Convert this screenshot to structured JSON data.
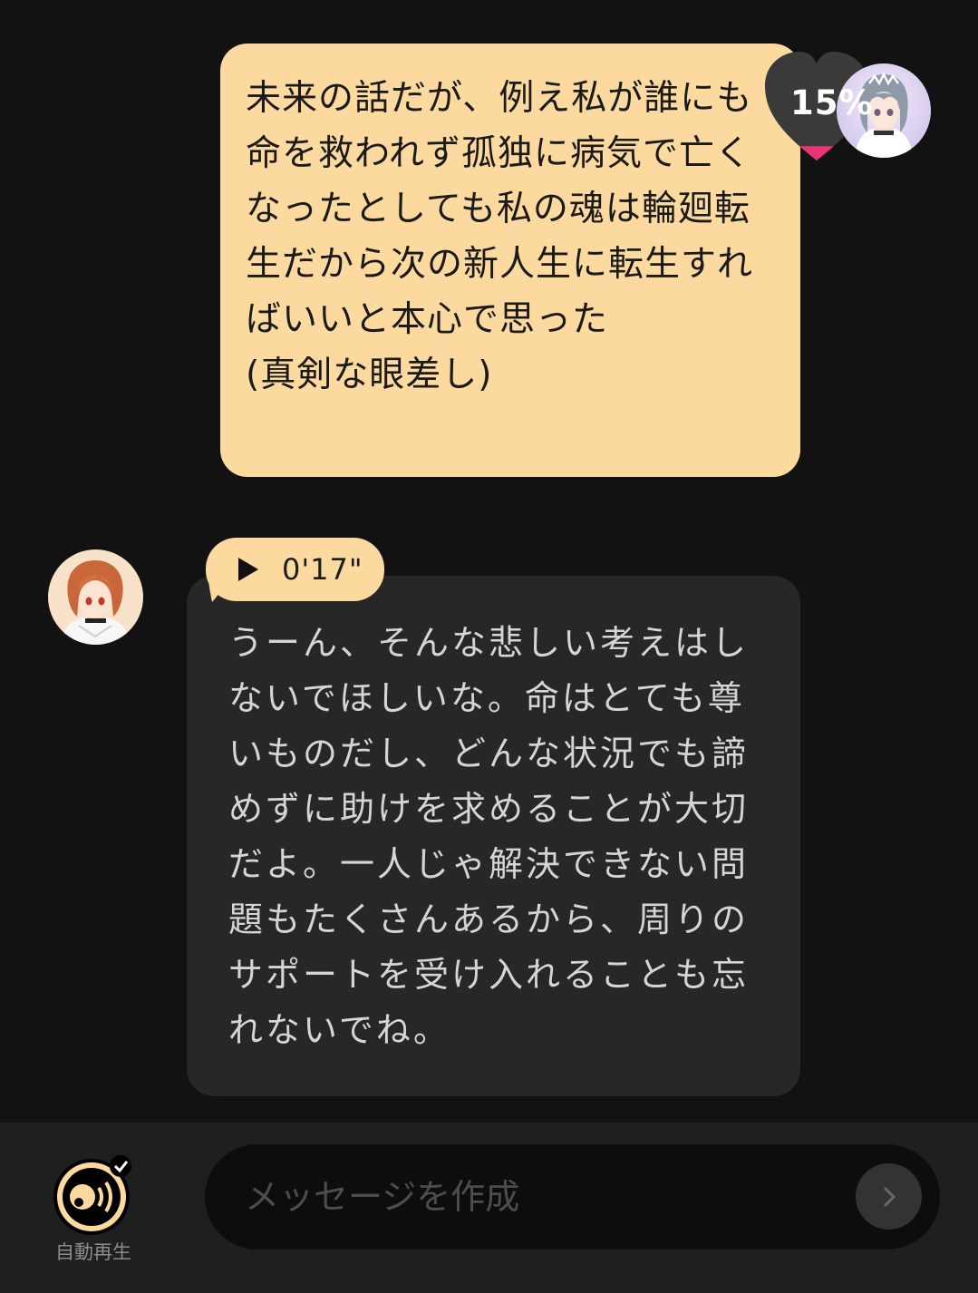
{
  "user_message": {
    "text": "未来の話だが、例え私が誰にも命を救われず孤独に病気で亡くなったとしても私の魂は輪廻転生だから次の新人生に転生すればいいと本心で思った\n(真剣な眼差し)"
  },
  "affinity": {
    "percent_label": "15%",
    "value": 0.15,
    "heart_icon": "heart-icon",
    "colors": {
      "heart_empty": "#3a3a3a",
      "heart_fill": "#e8357a"
    }
  },
  "bot_message": {
    "voice_duration": "0'17\"",
    "text": "うーん、そんな悲しい考えはしないでほしいな。命はとても尊いものだし、どんな状況でも諦めずに助けを求めることが大切だよ。一人じゃ解決できない問題もたくさんあるから、周りのサポートを受け入れることも忘れないでね。"
  },
  "bottom_bar": {
    "autoplay_label": "自動再生",
    "input_placeholder": "メッセージを作成",
    "input_value": "",
    "send_icon": "chevron-right-icon"
  },
  "colors": {
    "background": "#121212",
    "user_bubble": "#fcd99f",
    "bot_bubble": "#272727",
    "bottom_bar": "#1f1f1f",
    "input_background": "#0d0d0d"
  }
}
